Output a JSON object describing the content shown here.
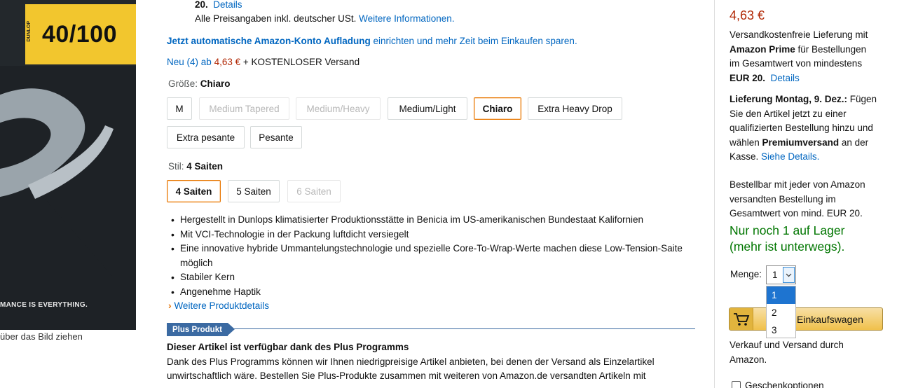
{
  "image": {
    "label_number": "40/100",
    "label_vertical": "DUNLOP",
    "slogan": "MANCE IS EVERYTHING.",
    "hint": "über das Bild ziehen"
  },
  "pricing": {
    "line1_bold": "20.",
    "line1_link": "Details",
    "line2_text": "Alle Preisangaben inkl. deutscher USt.",
    "line2_link": "Weitere Informationen.",
    "reload_bold": "Jetzt automatische Amazon-Konto Aufladung",
    "reload_rest": "einrichten und mehr Zeit beim Einkaufen sparen.",
    "new_link": "Neu (4) ab",
    "new_price": "4,63 €",
    "new_shipping": "+ KOSTENLOSER Versand"
  },
  "size": {
    "label": "Größe:",
    "selected": "Chiaro",
    "options": [
      "M",
      "Medium Tapered",
      "Medium/Heavy",
      "Medium/Light",
      "Chiaro",
      "Extra Heavy Drop",
      "Extra pesante",
      "Pesante"
    ]
  },
  "style": {
    "label": "Stil:",
    "selected": "4 Saiten",
    "options": [
      "4 Saiten",
      "5 Saiten",
      "6 Saiten"
    ]
  },
  "bullets": [
    "Hergestellt in Dunlops klimatisierter Produktionsstätte in Benicia im US-amerikanischen Bundestaat Kalifornien",
    "Mit VCI-Technologie in der Packung luftdicht versiegelt",
    "Eine innovative hybride Ummantelungstechnologie und spezielle Core-To-Wrap-Werte machen diese Low-Tension-Saite möglich",
    "Stabiler Kern",
    "Angenehme Haptik"
  ],
  "more_details_link": "Weitere Produktdetails",
  "plus": {
    "badge": "Plus Produkt",
    "heading": "Dieser Artikel ist verfügbar dank des Plus Programms",
    "body1": "Dank des Plus Programms können wir Ihnen niedrigpreisige Artikel anbieten, bei denen der Versand als Einzelartikel",
    "body2": "unwirtschaftlich wäre. Bestellen Sie Plus-Produkte zusammen mit weiteren von Amazon.de versandten Artikeln mit"
  },
  "buybox": {
    "price": "4,63 €",
    "ship_l1": "Versandkostenfreie Lieferung mit",
    "ship_l2_bold": "Amazon Prime",
    "ship_l2_rest": "für Bestellungen",
    "ship_l3": "im Gesamtwert von mindestens",
    "ship_l4_bold": "EUR 20.",
    "ship_l4_link": "Details",
    "deliv_l1_bold": "Lieferung Montag, 9. Dez.:",
    "deliv_l1_rest": "Fügen",
    "deliv_l2": "Sie den Artikel jetzt zu einer",
    "deliv_l3": "qualifizierten Bestellung hinzu und",
    "deliv_l4_pre": "wählen",
    "deliv_l4_bold": "Premiumversand",
    "deliv_l4_rest": "an der",
    "deliv_l5_pre": "Kasse.",
    "deliv_l5_link": "Siehe Details.",
    "avail_l1": "Bestellbar mit jeder von Amazon",
    "avail_l2": "versandten Bestellung im",
    "avail_l3": "Gesamtwert von mind. EUR 20.",
    "stock_l1": "Nur noch 1 auf Lager",
    "stock_l2": "(mehr ist unterwegs).",
    "qty_label": "Menge:",
    "qty_value": "1",
    "qty_options": [
      "1",
      "2",
      "3"
    ],
    "cart_label": "Einkaufswagen",
    "seller_l1": "Verkauf und Versand durch",
    "seller_l2": "Amazon.",
    "gift_label": "Geschenkoptionen"
  },
  "colors": {
    "price": "#b12704",
    "link": "#0066c0",
    "stock_green": "#007600",
    "selected_border": "#e77600",
    "plus_blue": "#3b6aa2"
  }
}
